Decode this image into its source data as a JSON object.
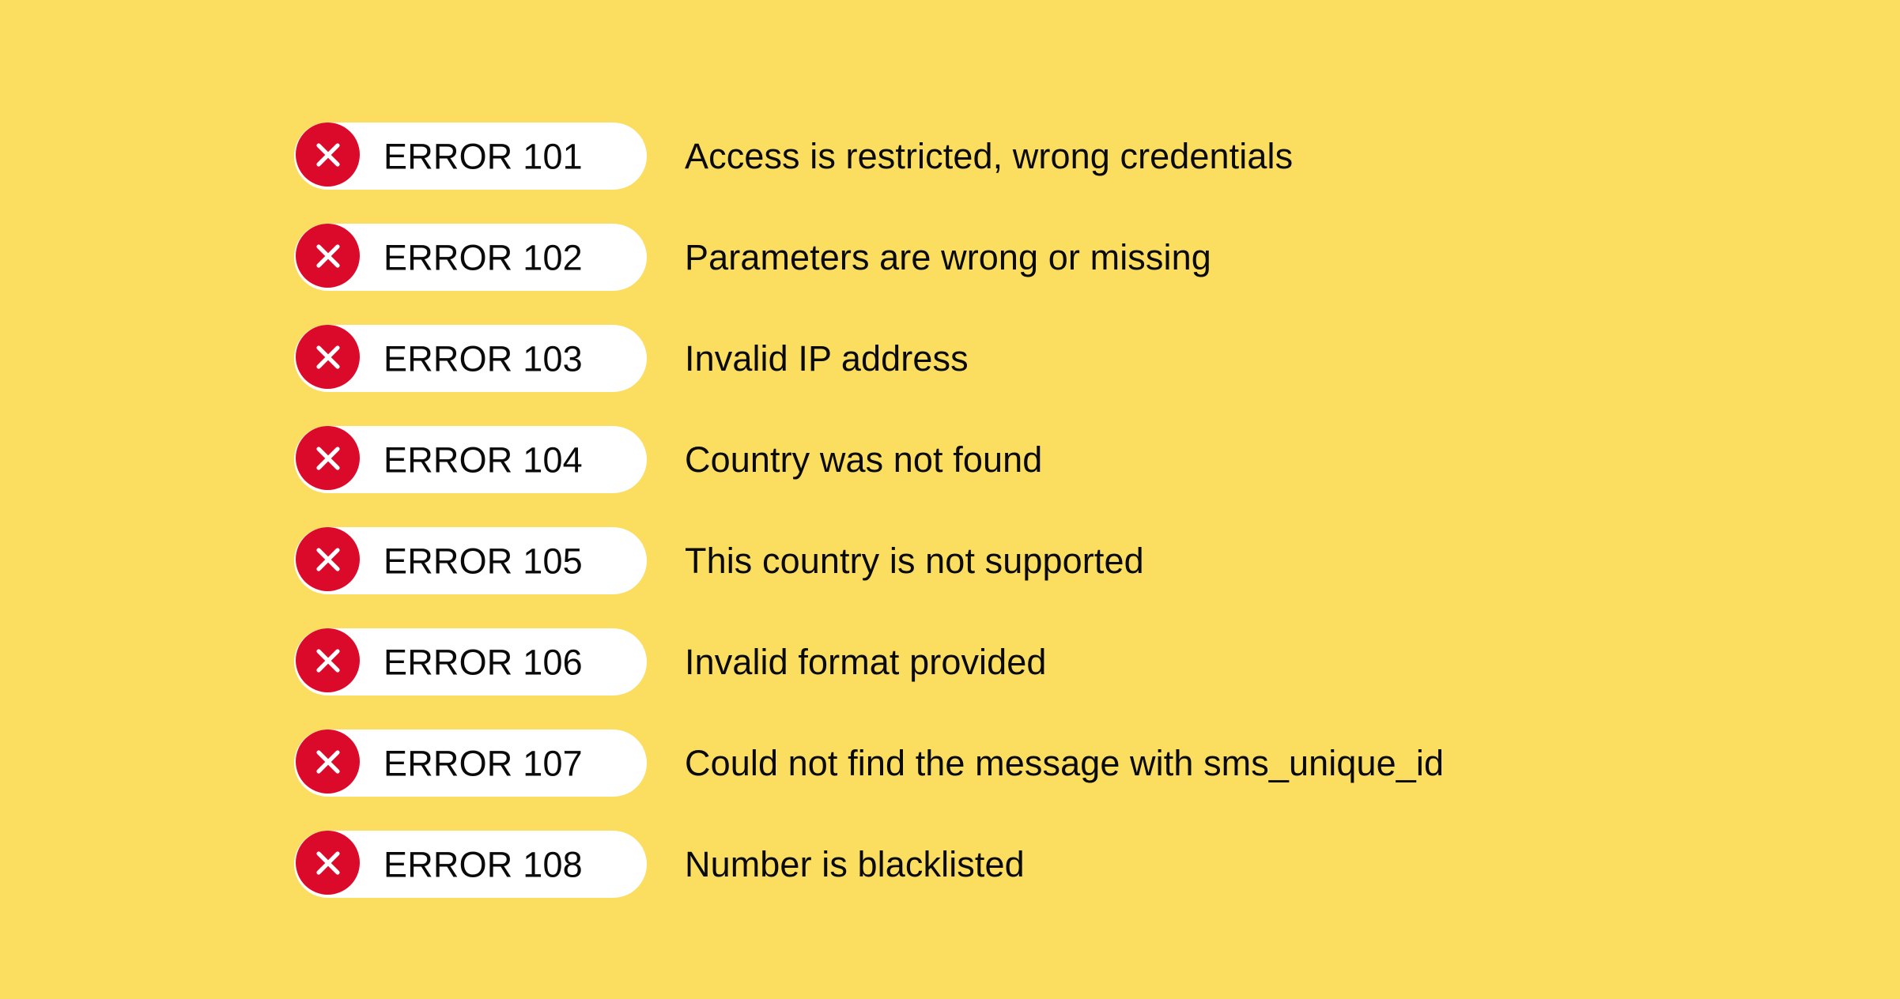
{
  "page": {
    "background_color": "#FBDE5F",
    "badge_color": "#DB0A2B",
    "pill_color": "#FFFFFF",
    "text_color": "#0A0A0A",
    "icon_name": "x-close-icon"
  },
  "errors": [
    {
      "code": "ERROR 101",
      "message": "Access is restricted, wrong credentials"
    },
    {
      "code": "ERROR 102",
      "message": "Parameters are wrong or missing"
    },
    {
      "code": "ERROR 103",
      "message": "Invalid IP address"
    },
    {
      "code": "ERROR 104",
      "message": "Country was not found"
    },
    {
      "code": "ERROR 105",
      "message": "This country is not supported"
    },
    {
      "code": "ERROR 106",
      "message": "Invalid format provided"
    },
    {
      "code": "ERROR 107",
      "message": "Could not find the message with sms_unique_id"
    },
    {
      "code": "ERROR 108",
      "message": "Number is blacklisted"
    }
  ]
}
